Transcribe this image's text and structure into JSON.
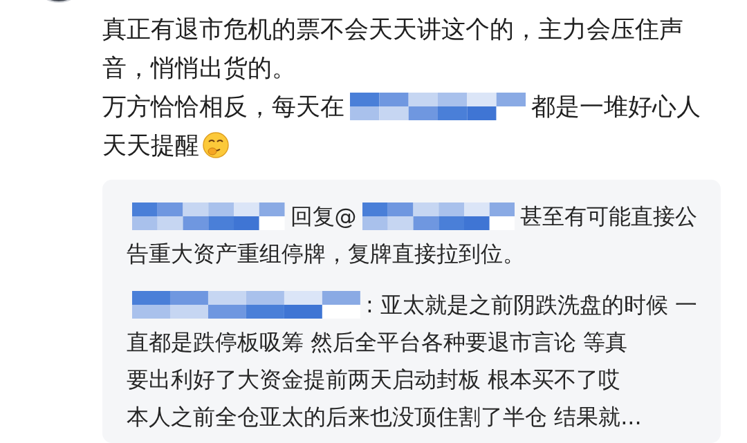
{
  "comment": {
    "lines": [
      [
        {
          "kind": "text",
          "text": "真正有退市危机的票不会天天讲这个的，主力会压住声"
        }
      ],
      [
        {
          "kind": "text",
          "text": "音，悄悄出货的。"
        }
      ],
      [
        {
          "kind": "text",
          "text": "万方恰恰相反，每天在"
        },
        {
          "kind": "mosaic"
        },
        {
          "kind": "text",
          "text": "都是一堆好心人"
        }
      ],
      [
        {
          "kind": "text",
          "text": "天天提醒"
        },
        {
          "kind": "emoji"
        }
      ]
    ]
  },
  "replies": [
    {
      "lines": [
        [
          {
            "kind": "mosaic"
          },
          {
            "kind": "text",
            "text": "回复@"
          },
          {
            "kind": "mosaic"
          },
          {
            "kind": "text",
            "text": "甚至有可能直接公"
          }
        ],
        [
          {
            "kind": "text",
            "text": "告重大资产重组停牌，复牌直接拉到位。"
          }
        ]
      ]
    },
    {
      "lines": [
        [
          {
            "kind": "mosaic"
          },
          {
            "kind": "text",
            "text": ": 亚太就是之前阴跌洗盘的时候 一"
          }
        ],
        [
          {
            "kind": "text",
            "text": "直都是跌停板吸筹 然后全平台各种要退市言论 等真"
          }
        ],
        [
          {
            "kind": "text",
            "text": "要出利好了大资金提前两天启动封板 根本买不了哎"
          }
        ],
        [
          {
            "kind": "text",
            "text": "本人之前全仓亚太的后来也没顶住割了半仓 结果就..."
          }
        ]
      ]
    }
  ]
}
